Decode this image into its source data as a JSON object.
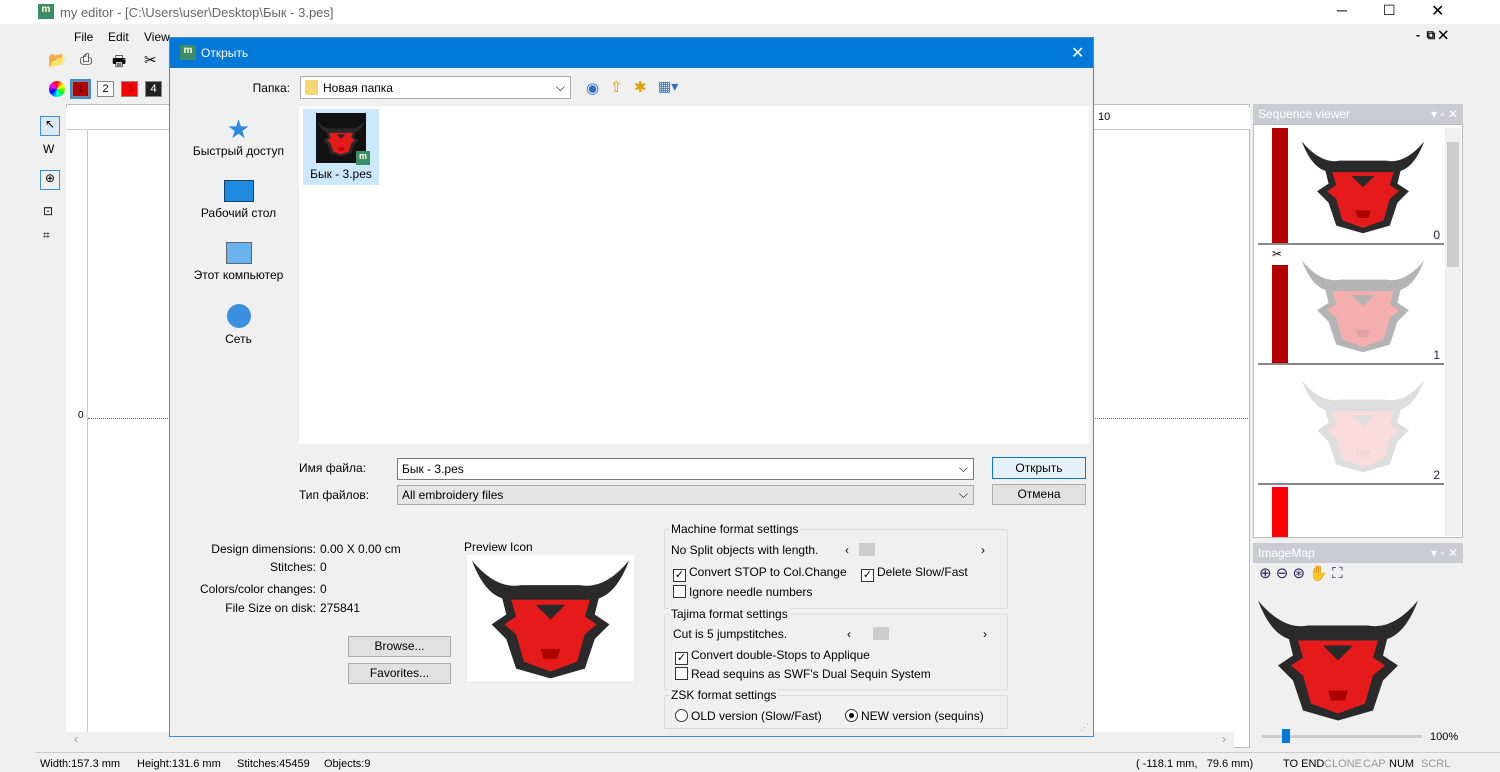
{
  "app": {
    "title": "my editor - [C:\\Users\\user\\Desktop\\Бык - 3.pes]"
  },
  "menu": [
    "File",
    "Edit",
    "View"
  ],
  "color_toolbar": [
    "1",
    "2",
    "3",
    "4"
  ],
  "colors": {
    "accent": "#0078d7",
    "thread1": "#b30000",
    "thread3": "#ff0000",
    "thread4": "#222222"
  },
  "ruler": {
    "label_10": "10",
    "left_mark": "0"
  },
  "dialog": {
    "title": "Открыть",
    "folder_label": "Папка:",
    "folder_value": "Новая папка",
    "places": [
      "Быстрый доступ",
      "Рабочий стол",
      "Этот компьютер",
      "Сеть"
    ],
    "files": [
      {
        "name": "Бык - 3.pes",
        "selected": true
      }
    ],
    "filename_label": "Имя файла:",
    "filename_value": "Бык - 3.pes",
    "filetype_label": "Тип файлов:",
    "filetype_value": "All embroidery files",
    "open_button": "Открыть",
    "cancel_button": "Отмена",
    "info": [
      {
        "label": "Design dimensions:",
        "value": "0.00 X 0.00 cm"
      },
      {
        "label": "Stitches:",
        "value": "0"
      },
      {
        "label": "Colors/color changes:",
        "value": "0"
      },
      {
        "label": "File Size on disk:",
        "value": "275841"
      }
    ],
    "browse_button": "Browse...",
    "favorites_button": "Favorites...",
    "preview_label": "Preview Icon",
    "machine": {
      "title": "Machine format settings",
      "split_label": "No Split objects with length.",
      "convert_stop": "Convert STOP to Col.Change",
      "convert_stop_checked": true,
      "delete_slow": "Delete Slow/Fast",
      "delete_slow_checked": true,
      "ignore_needle": "Ignore needle numbers",
      "ignore_needle_checked": false
    },
    "tajima": {
      "title": "Tajima format settings",
      "cut_label": "Cut is 5 jumpstitches.",
      "double_stops": "Convert double-Stops to Applique",
      "double_stops_checked": true,
      "sequins": "Read sequins as SWF's Dual Sequin System",
      "sequins_checked": false
    },
    "zsk": {
      "title": "ZSK format settings",
      "old": "OLD version (Slow/Fast)",
      "new": "NEW version (sequins)",
      "selected": "new"
    }
  },
  "sequence_viewer": {
    "title": "Sequence viewer",
    "items": [
      "0",
      "1",
      "2"
    ]
  },
  "imagemap": {
    "title": "ImageMap",
    "zoom": "100%"
  },
  "status": {
    "width": "Width:157.3 mm",
    "height": "Height:131.6 mm",
    "stitches": "Stitches:45459",
    "objects": "Objects:9",
    "coords": "( -118.1 mm,   79.6 mm)",
    "to_end": "TO END",
    "clone": "CLONE",
    "cap": "CAP",
    "num": "NUM",
    "scrl": "SCRL"
  }
}
